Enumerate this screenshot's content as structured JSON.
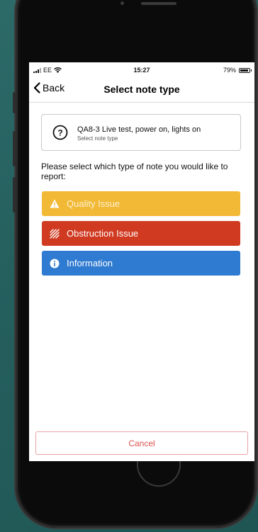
{
  "status_bar": {
    "carrier": "EE",
    "time": "15:27",
    "battery": "79%",
    "battery_level": 0.79
  },
  "nav": {
    "back_label": "Back",
    "title": "Select note type"
  },
  "task": {
    "title": "QA8-3 Live test, power on, lights on",
    "subtitle": "Select note type",
    "icon": "question-circle-icon"
  },
  "prompt": "Please select which type of note you would like to report:",
  "note_types": [
    {
      "label": "Quality Issue",
      "icon": "warning-icon",
      "color": "#f1b935"
    },
    {
      "label": "Obstruction Issue",
      "icon": "obstruction-icon",
      "color": "#cf3a21"
    },
    {
      "label": "Information",
      "icon": "info-icon",
      "color": "#2f7bd1"
    }
  ],
  "cancel_label": "Cancel",
  "colors": {
    "background": "#245e5d",
    "cancel_text": "#d9534f"
  }
}
